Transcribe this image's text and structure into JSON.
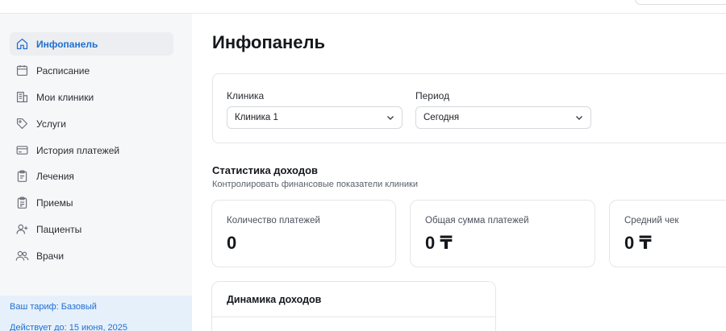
{
  "nav": {
    "items": [
      {
        "label": "Инфопанель",
        "icon": "home-icon",
        "active": true
      },
      {
        "label": "Расписание",
        "icon": "calendar-icon",
        "active": false
      },
      {
        "label": "Мои клиники",
        "icon": "building-icon",
        "active": false
      },
      {
        "label": "Услуги",
        "icon": "tag-icon",
        "active": false
      },
      {
        "label": "История платежей",
        "icon": "card-icon",
        "active": false
      },
      {
        "label": "Лечения",
        "icon": "clipboard-icon",
        "active": false
      },
      {
        "label": "Приемы",
        "icon": "clipboard-list-icon",
        "active": false
      },
      {
        "label": "Пациенты",
        "icon": "user-add-icon",
        "active": false
      },
      {
        "label": "Врачи",
        "icon": "users-icon",
        "active": false
      }
    ]
  },
  "plan": {
    "tariff": "Ваш тариф: Базовый",
    "valid_until": "Действует до: 15 июня, 2025"
  },
  "page": {
    "title": "Инфопанель"
  },
  "filters": {
    "clinic_label": "Клиника",
    "clinic_value": "Клиника 1",
    "period_label": "Период",
    "period_value": "Сегодня"
  },
  "income": {
    "title": "Статистика доходов",
    "subtitle": "Контролировать финансовые показатели клиники"
  },
  "stats": [
    {
      "label": "Количество платежей",
      "value": "0"
    },
    {
      "label": "Общая сумма платежей",
      "value": "0 ₸"
    },
    {
      "label": "Средний чек",
      "value": "0 ₸"
    }
  ],
  "dynamics": {
    "title": "Динамика доходов"
  },
  "colors": {
    "accent": "#1f6fd1",
    "active_bg": "#eceef1",
    "plan_bg": "#e6f0fb"
  }
}
